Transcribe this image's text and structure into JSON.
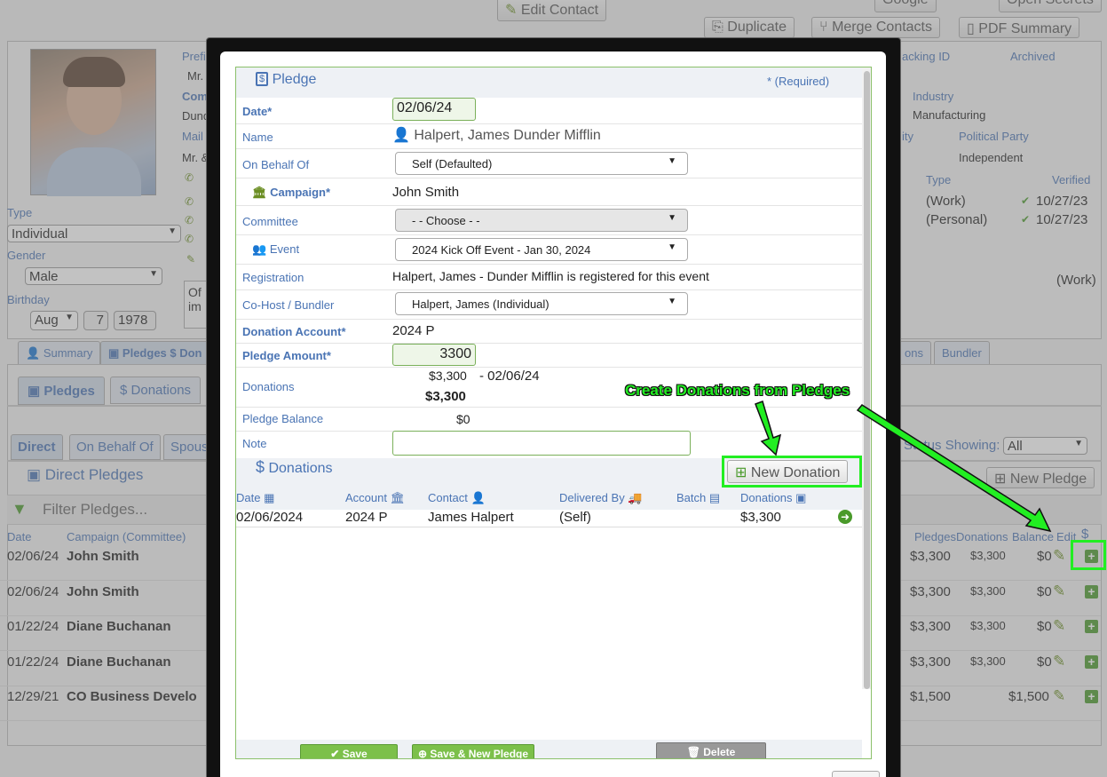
{
  "top": {
    "edit_contact": "Edit Contact",
    "google": "Google",
    "open_secrets": "Open Secrets",
    "duplicate": "Duplicate",
    "merge_contacts": "Merge Contacts",
    "pdf_summary": "PDF Summary"
  },
  "profile": {
    "prefix_label": "Prefi",
    "prefix_value": "Mr.",
    "comp_label": "Com",
    "comp_value": "Dund",
    "mail_label": "Mail",
    "mail_value": "Mr. &",
    "type_label": "Type",
    "type_value": "Individual",
    "gender_label": "Gender",
    "gender_value": "Male",
    "birthday_label": "Birthday",
    "birth_month": "Aug",
    "birth_day": "7",
    "birth_year": "1978",
    "note_frag1": "Of",
    "note_frag2": "im",
    "tracking_label": "acking ID",
    "archived_label": "Archived",
    "industry_label": "Industry",
    "industry_value": "Manufacturing",
    "city_label": "ity",
    "party_label": "Political Party",
    "party_value": "Independent",
    "ptype_label": "Type",
    "verified_label": "Verified",
    "phone1_type": "(Work)",
    "phone1_verified": "10/27/23",
    "phone2_type": "(Personal)",
    "phone2_verified": "10/27/23",
    "addr_type": "(Work)"
  },
  "tabs": {
    "summary": "Summary",
    "pledges_don": "Pledges $ Don",
    "ons": "ons",
    "bundler": "Bundler",
    "pledges": "Pledges",
    "donations": "Donations",
    "direct": "Direct",
    "on_behalf_of": "On Behalf Of",
    "spouse": "Spous"
  },
  "list": {
    "status_label": "Status Showing:",
    "status_value": "All",
    "section_title": "Direct Pledges",
    "new_pledge": "New Pledge",
    "filter_placeholder": "Filter Pledges...",
    "col_date": "Date",
    "col_campaign": "Campaign (Committee)",
    "col_pledges": "Pledges",
    "col_donations": "Donations",
    "col_balance": "Balance",
    "col_edit": "Edit",
    "col_dollar": "$",
    "rows": [
      {
        "date": "02/06/24",
        "campaign": "John Smith",
        "pledges": "$3,300",
        "donations": "$3,300",
        "balance": "$0"
      },
      {
        "date": "02/06/24",
        "campaign": "John Smith",
        "pledges": "$3,300",
        "donations": "$3,300",
        "balance": "$0"
      },
      {
        "date": "01/22/24",
        "campaign": "Diane Buchanan",
        "pledges": "$3,300",
        "donations": "$3,300",
        "balance": "$0"
      },
      {
        "date": "01/22/24",
        "campaign": "Diane Buchanan",
        "pledges": "$3,300",
        "donations": "$3,300",
        "balance": "$0"
      },
      {
        "date": "12/29/21",
        "campaign": "CO Business Develo",
        "pledges": "$1,500",
        "donations": "",
        "balance": "$1,500"
      }
    ]
  },
  "modal": {
    "title": "Pledge",
    "required_note": "* (Required)",
    "date_label": "Date*",
    "date_value": "02/06/24",
    "name_label": "Name",
    "name_value": "Halpert, James Dunder Mifflin",
    "behalf_label": "On Behalf Of",
    "behalf_value": "Self (Defaulted)",
    "campaign_label": "Campaign*",
    "campaign_value": "John Smith",
    "committee_label": "Committee",
    "committee_value": "- - Choose - -",
    "event_label": "Event",
    "event_value": "2024 Kick Off Event - Jan 30, 2024",
    "registration_label": "Registration",
    "registration_value": "Halpert, James - Dunder Mifflin is registered for this event",
    "cohost_label": "Co-Host / Bundler",
    "cohost_value": "Halpert, James (Individual)",
    "account_label": "Donation Account*",
    "account_value": "2024 P",
    "amount_label": "Pledge Amount*",
    "amount_value": "3300",
    "donations_label": "Donations",
    "donation_line": "$3,300",
    "donation_date": "- 02/06/24",
    "donation_total": "$3,300",
    "balance_label": "Pledge Balance",
    "balance_value": "$0",
    "note_label": "Note",
    "donations_section": "Donations",
    "new_donation": "New Donation",
    "annotation": "Create Donations from Pledges",
    "cols": {
      "date": "Date",
      "account": "Account",
      "contact": "Contact",
      "delivered": "Delivered By",
      "batch": "Batch",
      "donations": "Donations"
    },
    "don_row": {
      "date": "02/06/2024",
      "account": "2024 P",
      "contact": "James Halpert",
      "delivered": "(Self)",
      "amount": "$3,300"
    },
    "save": "Save",
    "save_new": "Save & New Pledge",
    "delete": "Delete"
  },
  "colors": {
    "accent": "#4a74b4",
    "green": "#22ee22",
    "save_green": "#7cc04a"
  }
}
